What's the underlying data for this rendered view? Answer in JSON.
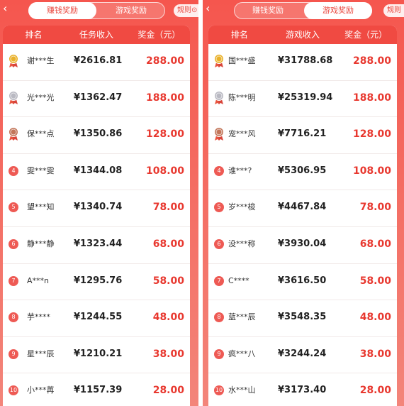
{
  "colors": {
    "panel_red": "#f5564e",
    "header_red": "#f04a42",
    "bonus_red": "#e8382f",
    "gold": "#e9b12a",
    "silver": "#b9b9c2",
    "bronze": "#c2765a"
  },
  "left": {
    "back_icon": "‹",
    "tabs": [
      {
        "label": "赚钱奖励",
        "active": false
      },
      {
        "label": "游戏奖励",
        "active": false
      }
    ],
    "rules_label": "规则",
    "rules_icon": "⊙",
    "header": {
      "rank": "排名",
      "income": "任务收入",
      "bonus": "奖金（元）"
    },
    "rows": [
      {
        "rank": "1",
        "medal": "gold",
        "name": "谢***生",
        "income": "¥2616.81",
        "bonus": "288.00"
      },
      {
        "rank": "2",
        "medal": "silver",
        "name": "光***光",
        "income": "¥1362.47",
        "bonus": "188.00"
      },
      {
        "rank": "3",
        "medal": "bronze",
        "name": "保***点",
        "income": "¥1350.86",
        "bonus": "128.00"
      },
      {
        "rank": "4",
        "name": "雯***雯",
        "income": "¥1344.08",
        "bonus": "108.00"
      },
      {
        "rank": "5",
        "name": "望***知",
        "income": "¥1340.74",
        "bonus": "78.00"
      },
      {
        "rank": "6",
        "name": "静***静",
        "income": "¥1323.44",
        "bonus": "68.00"
      },
      {
        "rank": "7",
        "name": "A***n",
        "income": "¥1295.76",
        "bonus": "58.00"
      },
      {
        "rank": "8",
        "name": "芋****",
        "income": "¥1244.55",
        "bonus": "48.00"
      },
      {
        "rank": "9",
        "name": "星***辰",
        "income": "¥1210.21",
        "bonus": "38.00"
      },
      {
        "rank": "10",
        "name": "小***苒",
        "income": "¥1157.39",
        "bonus": "28.00"
      }
    ]
  },
  "right": {
    "back_icon": "‹",
    "tabs": [
      {
        "label": "赚钱奖励",
        "active": false
      },
      {
        "label": "游戏奖励",
        "active": true
      }
    ],
    "rules_label": "规则",
    "header": {
      "rank": "排名",
      "income": "游戏收入",
      "bonus": "奖金（元）"
    },
    "rows": [
      {
        "rank": "1",
        "medal": "gold",
        "name": "国***盛",
        "income": "¥31788.68",
        "bonus": "288.00"
      },
      {
        "rank": "2",
        "medal": "silver",
        "name": "陈***明",
        "income": "¥25319.94",
        "bonus": "188.00"
      },
      {
        "rank": "3",
        "medal": "bronze",
        "name": "宠***风",
        "income": "¥7716.21",
        "bonus": "128.00"
      },
      {
        "rank": "4",
        "name": "谁***?",
        "income": "¥5306.95",
        "bonus": "108.00"
      },
      {
        "rank": "5",
        "name": "岁***梭",
        "income": "¥4467.84",
        "bonus": "78.00"
      },
      {
        "rank": "6",
        "name": "没***称",
        "income": "¥3930.04",
        "bonus": "68.00"
      },
      {
        "rank": "7",
        "name": "C****",
        "income": "¥3616.50",
        "bonus": "58.00"
      },
      {
        "rank": "8",
        "name": "蓝***辰",
        "income": "¥3548.35",
        "bonus": "48.00"
      },
      {
        "rank": "9",
        "name": "疯***八",
        "income": "¥3244.24",
        "bonus": "38.00"
      },
      {
        "rank": "10",
        "name": "水***山",
        "income": "¥3173.40",
        "bonus": "28.00"
      }
    ]
  }
}
